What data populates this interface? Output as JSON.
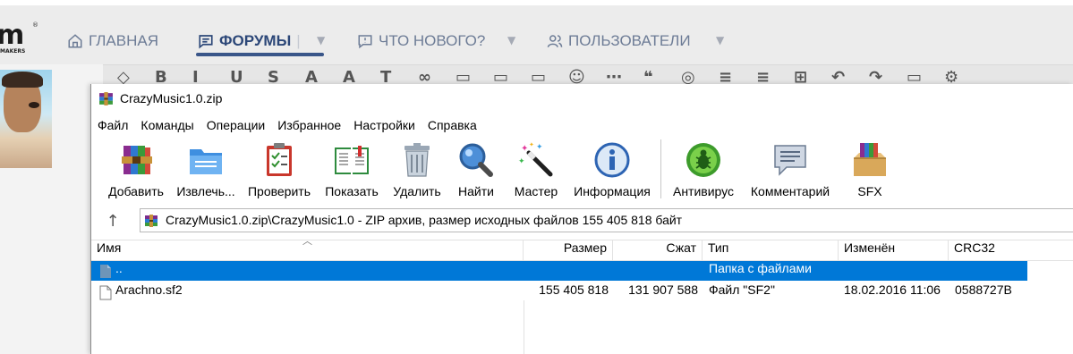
{
  "forum": {
    "logo_sub": "MAKERS",
    "nav": [
      {
        "label": "ГЛАВНАЯ",
        "icon": "home-icon"
      },
      {
        "label": "ФОРУМЫ",
        "icon": "forum-icon"
      },
      {
        "label": "ЧТО НОВОГО?",
        "icon": "whats-new-icon"
      },
      {
        "label": "ПОЛЬЗОВАТЕЛИ",
        "icon": "users-icon"
      }
    ],
    "colors": {
      "nav_active": "#2c4778",
      "nav_inactive": "#6d7c96"
    }
  },
  "window": {
    "title": "CrazyMusic1.0.zip",
    "menu": [
      "Файл",
      "Команды",
      "Операции",
      "Избранное",
      "Настройки",
      "Справка"
    ],
    "toolbar": [
      {
        "label": "Добавить",
        "icon": "add-archive-icon"
      },
      {
        "label": "Извлечь...",
        "icon": "extract-folder-icon"
      },
      {
        "label": "Проверить",
        "icon": "test-checklist-icon"
      },
      {
        "label": "Показать",
        "icon": "view-book-icon"
      },
      {
        "label": "Удалить",
        "icon": "delete-trash-icon"
      },
      {
        "label": "Найти",
        "icon": "find-magnifier-icon"
      },
      {
        "label": "Мастер",
        "icon": "wizard-wand-icon"
      },
      {
        "label": "Информация",
        "icon": "info-icon"
      },
      {
        "label": "Антивирус",
        "icon": "antivirus-bug-icon"
      },
      {
        "label": "Комментарий",
        "icon": "comment-icon"
      },
      {
        "label": "SFX",
        "icon": "sfx-box-icon"
      }
    ],
    "path": "CrazyMusic1.0.zip\\CrazyMusic1.0 - ZIP архив, размер исходных файлов 155 405 818 байт",
    "columns": [
      "Имя",
      "Размер",
      "Сжат",
      "Тип",
      "Изменён",
      "CRC32"
    ],
    "rows": [
      {
        "name": "..",
        "size": "",
        "packed": "",
        "type": "Папка с файлами",
        "modified": "",
        "crc": "",
        "selected": true
      },
      {
        "name": "Arachno.sf2",
        "size": "155 405 818",
        "packed": "131 907 588",
        "type": "Файл \"SF2\"",
        "modified": "18.02.2016 11:06",
        "crc": "0588727B",
        "selected": false
      }
    ],
    "colors": {
      "selection": "#0078d7"
    }
  }
}
